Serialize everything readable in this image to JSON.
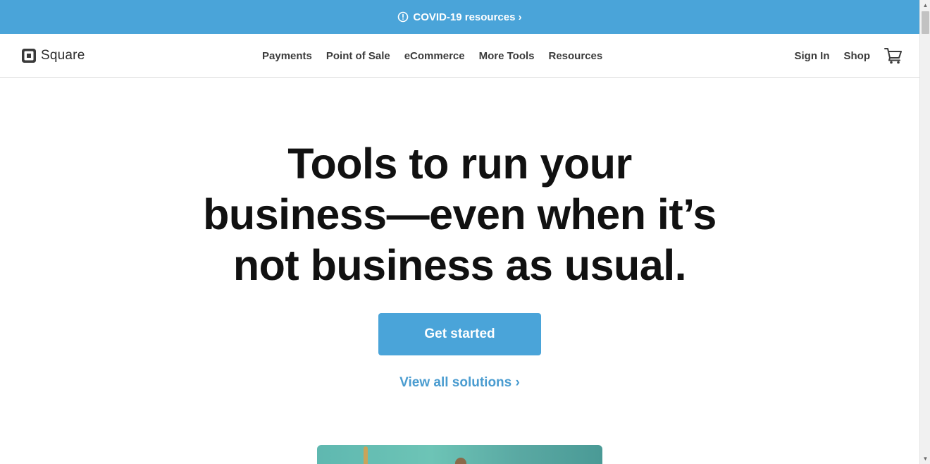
{
  "banner": {
    "text": "COVID-19 resources ›",
    "icon": "alert-circle-icon",
    "color": "#4aa4d9"
  },
  "nav": {
    "logo_text": "Square",
    "links": [
      "Payments",
      "Point of Sale",
      "eCommerce",
      "More Tools",
      "Resources"
    ],
    "sign_in": "Sign In",
    "shop": "Shop",
    "cart_icon": "cart-icon"
  },
  "hero": {
    "headline": "Tools to run your business—even when it’s not business as usual.",
    "cta_label": "Get started",
    "solutions_link": "View all solutions ›",
    "accent_color": "#4aa4d9"
  }
}
